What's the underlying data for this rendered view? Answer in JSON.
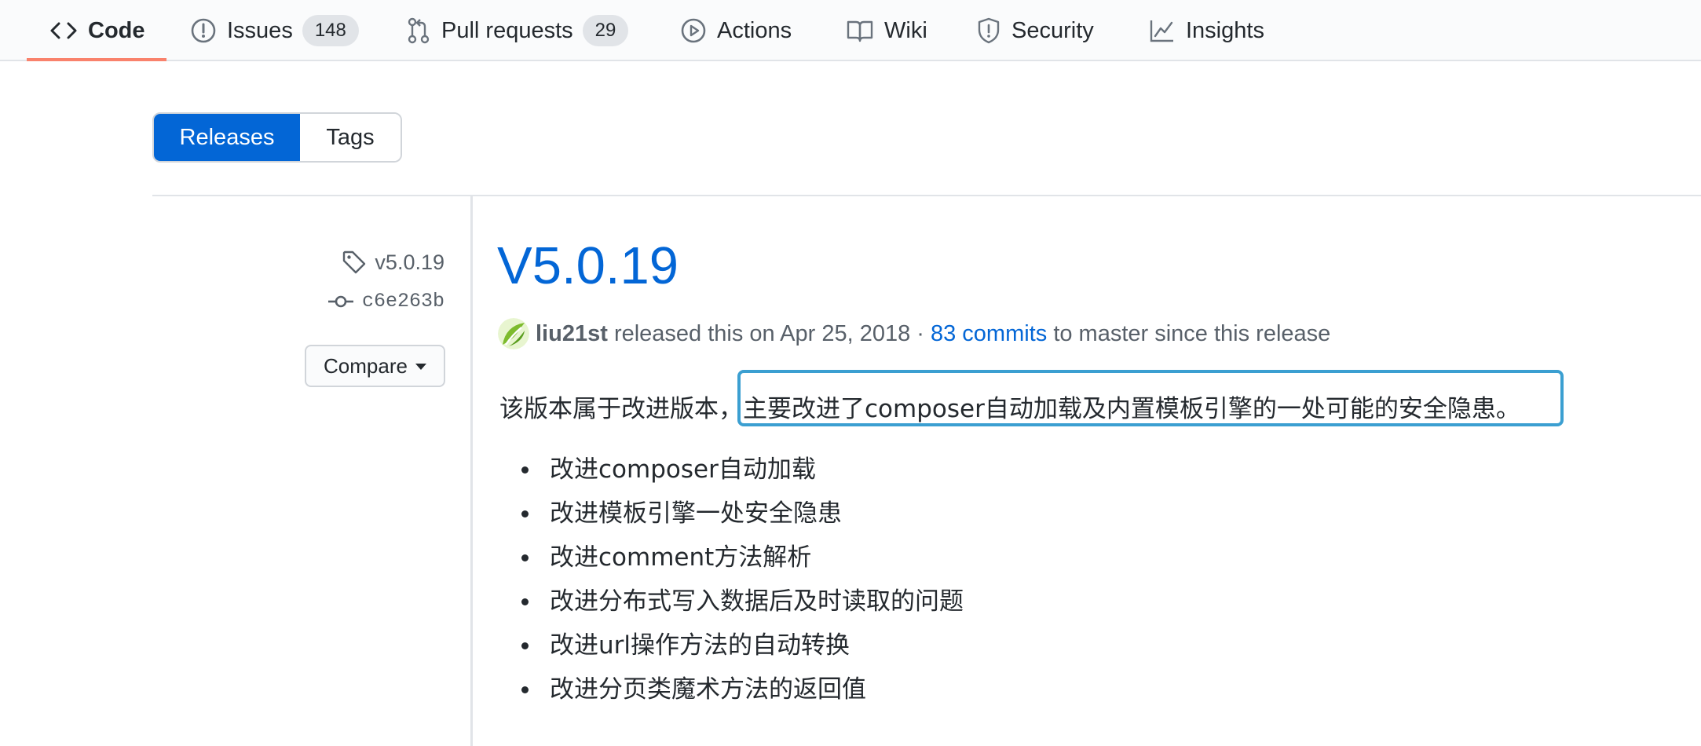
{
  "repo_nav": {
    "tabs": [
      {
        "label": "Code",
        "icon": "code-icon",
        "selected": true
      },
      {
        "label": "Issues",
        "icon": "issue-opened-icon",
        "count": "148"
      },
      {
        "label": "Pull requests",
        "icon": "git-pull-request-icon",
        "count": "29"
      },
      {
        "label": "Actions",
        "icon": "play-icon"
      },
      {
        "label": "Wiki",
        "icon": "book-icon"
      },
      {
        "label": "Security",
        "icon": "shield-icon"
      },
      {
        "label": "Insights",
        "icon": "graph-icon"
      }
    ],
    "accent_color": "#f9826c"
  },
  "subnav": {
    "releases_label": "Releases",
    "tags_label": "Tags",
    "active": "Releases",
    "active_color": "#0366d6"
  },
  "release": {
    "tag": "v5.0.19",
    "commit": "c6e263b",
    "compare_label": "Compare",
    "title": "V5.0.19",
    "author": "liu21st",
    "released_text": "released this on Apr 25, 2018 ·",
    "commits_link": "83 commits",
    "commits_suffix": "to master since this release",
    "summary": "该版本属于改进版本，主要改进了composer自动加载及内置模板引擎的一处可能的安全隐患。",
    "notes": [
      "改进composer自动加载",
      "改进模板引擎一处安全隐患",
      "改进comment方法解析",
      "改进分布式写入数据后及时读取的问题",
      "改进url操作方法的自动转换",
      "改进分页类魔术方法的返回值"
    ],
    "highlight_color": "#3b9fd1"
  }
}
